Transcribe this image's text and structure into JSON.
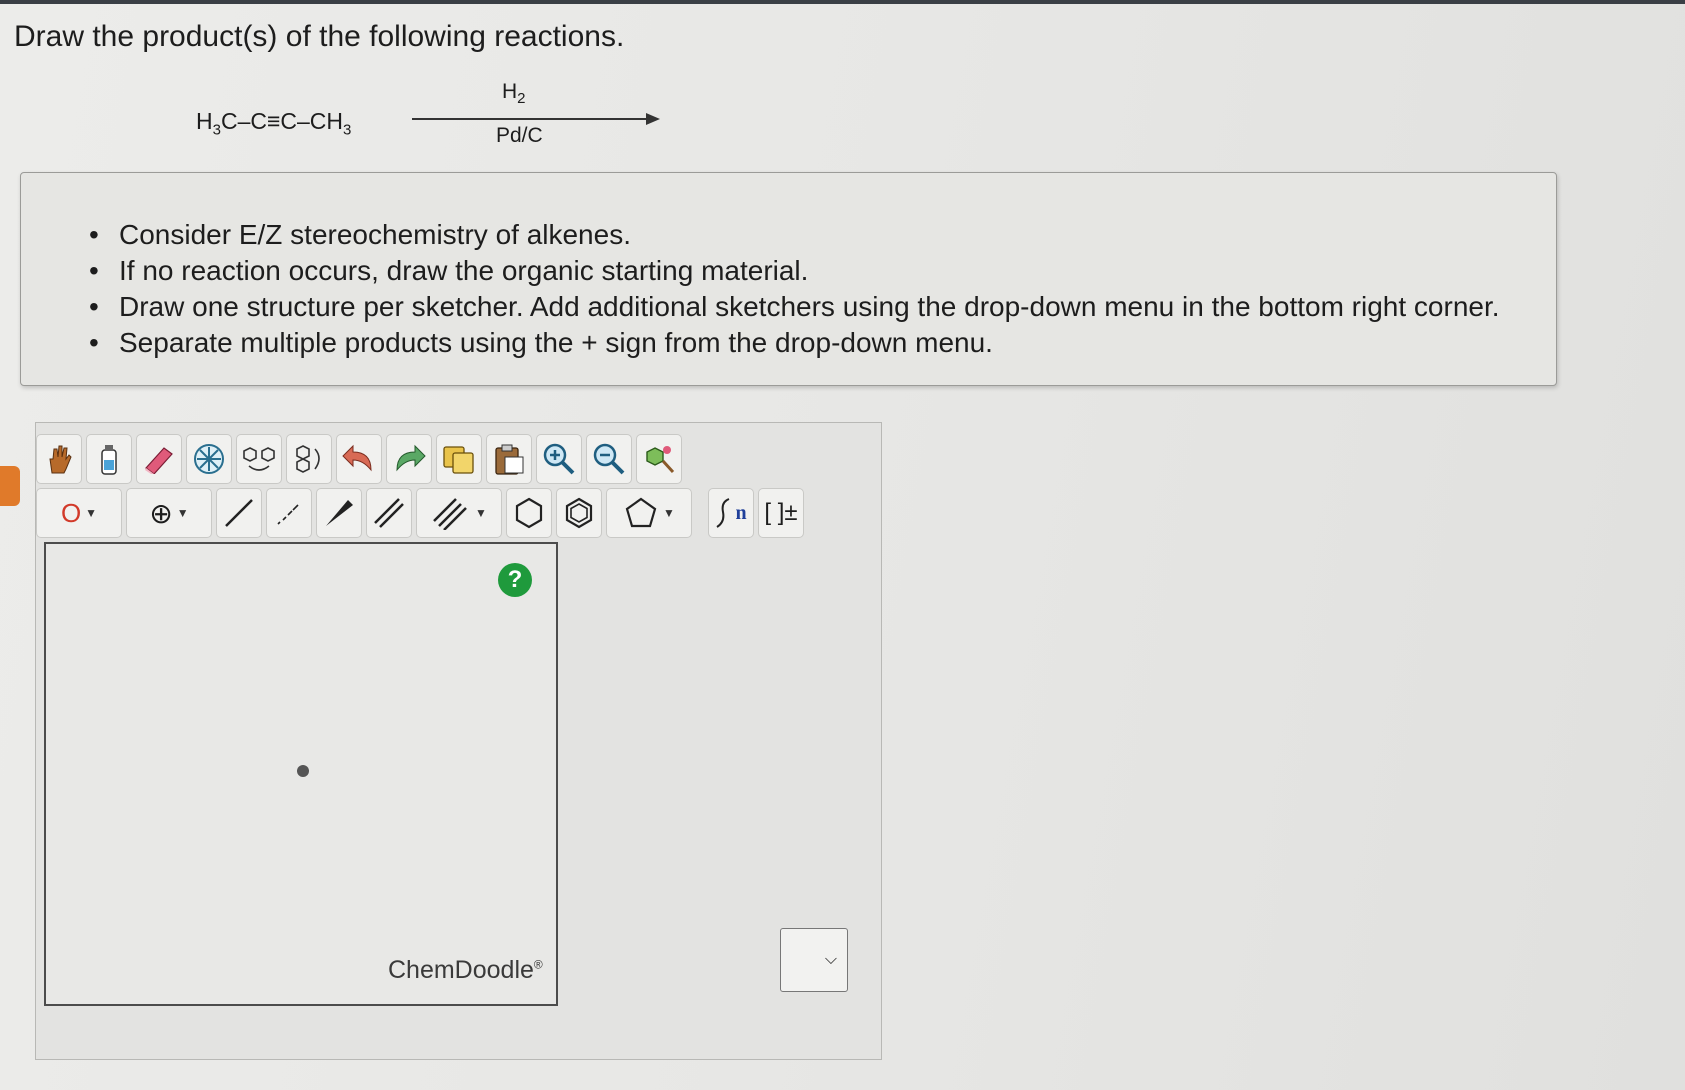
{
  "question": "Draw the product(s) of the following reactions.",
  "reaction": {
    "reactant_parts": [
      "H",
      "3",
      "C–C≡C–CH",
      "3"
    ],
    "reagent_above_parts": [
      "H",
      "2"
    ],
    "reagent_below": "Pd/C"
  },
  "instructions": [
    "Consider E/Z stereochemistry of alkenes.",
    "If no reaction occurs, draw the organic starting material.",
    "Draw one structure per sketcher. Add additional sketchers using the drop-down menu in the bottom right corner.",
    "Separate multiple products using the + sign from the drop-down menu."
  ],
  "toolbar": {
    "row1": [
      "hand-icon",
      "clear-icon",
      "eraser-icon",
      "templates-icon",
      "ring-link-icon",
      "ring-chain-icon",
      "undo-icon",
      "redo-icon",
      "copy-icon",
      "paste-icon",
      "zoom-in-icon",
      "zoom-out-icon",
      "clean-icon"
    ],
    "element_label": "O",
    "charge_label": "⊕",
    "ring_bracket_label": "[ ]±",
    "repeat_label": "n"
  },
  "sketcher": {
    "help_label": "?",
    "brand": "ChemDoodle",
    "brand_mark": "®"
  },
  "add_sketcher_dropdown": {
    "selected": "",
    "caret": "⌵"
  }
}
